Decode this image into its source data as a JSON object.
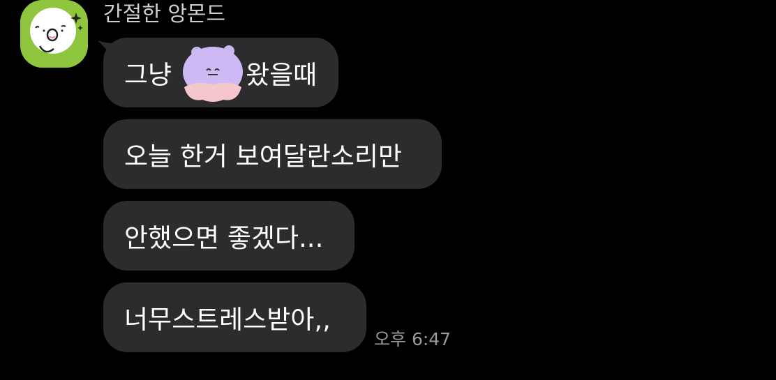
{
  "chat": {
    "sender_name": "간절한 앙몬드",
    "avatar_icon": "smiling-face-sticker-icon",
    "avatar_color": "#8fc63d",
    "bubble_color": "#2c2c2e",
    "messages": [
      {
        "before": "그냥",
        "sticker": "purple-bear-face-icon",
        "after": "왔을때"
      },
      {
        "text": "오늘 한거 보여달란소리만"
      },
      {
        "text": "안했으면 좋겠다..."
      },
      {
        "text": "너무스트레스받아,,"
      }
    ],
    "timestamp": "오후 6:47"
  }
}
